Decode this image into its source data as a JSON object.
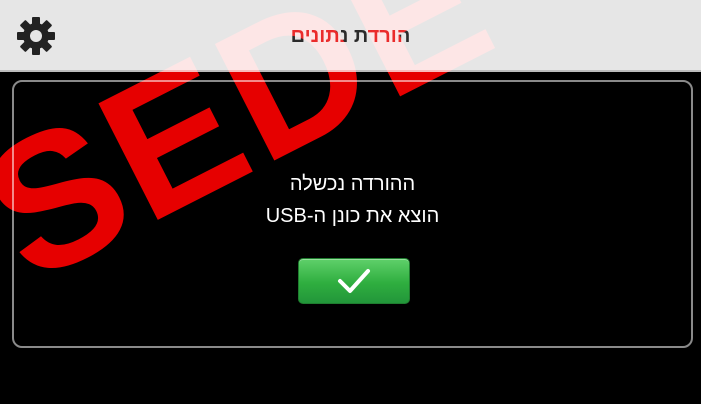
{
  "header": {
    "title": "הורדת נתונים",
    "settings_icon": "gear-icon"
  },
  "dialog": {
    "line1": "ההורדה נכשלה",
    "line2": "הוצא את כונן ה-USB",
    "ok_icon": "checkmark-icon"
  },
  "watermark": {
    "text": "SEDE"
  },
  "colors": {
    "header_bg": "#e6e6e6",
    "screen_bg": "#000000",
    "ok_green": "#2fae3f",
    "watermark_red": "#ff0000"
  }
}
